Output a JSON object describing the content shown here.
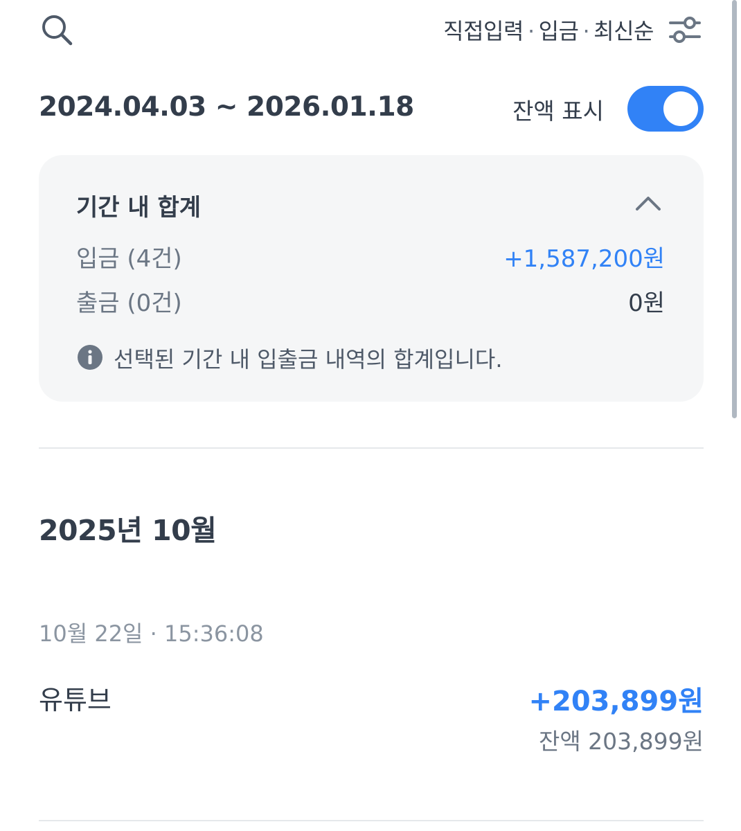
{
  "header": {
    "filter": {
      "type": "직접입력",
      "kind": "입금",
      "order": "최신순",
      "separator": "·"
    }
  },
  "period": {
    "range": "2024.04.03 ~ 2026.01.18",
    "balance_label": "잔액 표시",
    "balance_toggle_on": true
  },
  "summary": {
    "title": "기간 내 합계",
    "deposit": {
      "label": "입금 (4건)",
      "amount": "+1,587,200원"
    },
    "withdrawal": {
      "label": "출금 (0건)",
      "amount": "0원"
    },
    "note": "선택된 기간 내 입출금 내역의 합계입니다."
  },
  "history": {
    "month": "2025년 10월",
    "transactions": [
      {
        "datetime": "10월 22일 · 15:36:08",
        "name": "유튜브",
        "amount": "+203,899원",
        "balance": "잔액 203,899원"
      }
    ]
  },
  "colors": {
    "accent": "#3182f6",
    "text_primary": "#333d4b",
    "text_secondary": "#6b7684",
    "card_bg": "#f5f6f7"
  }
}
